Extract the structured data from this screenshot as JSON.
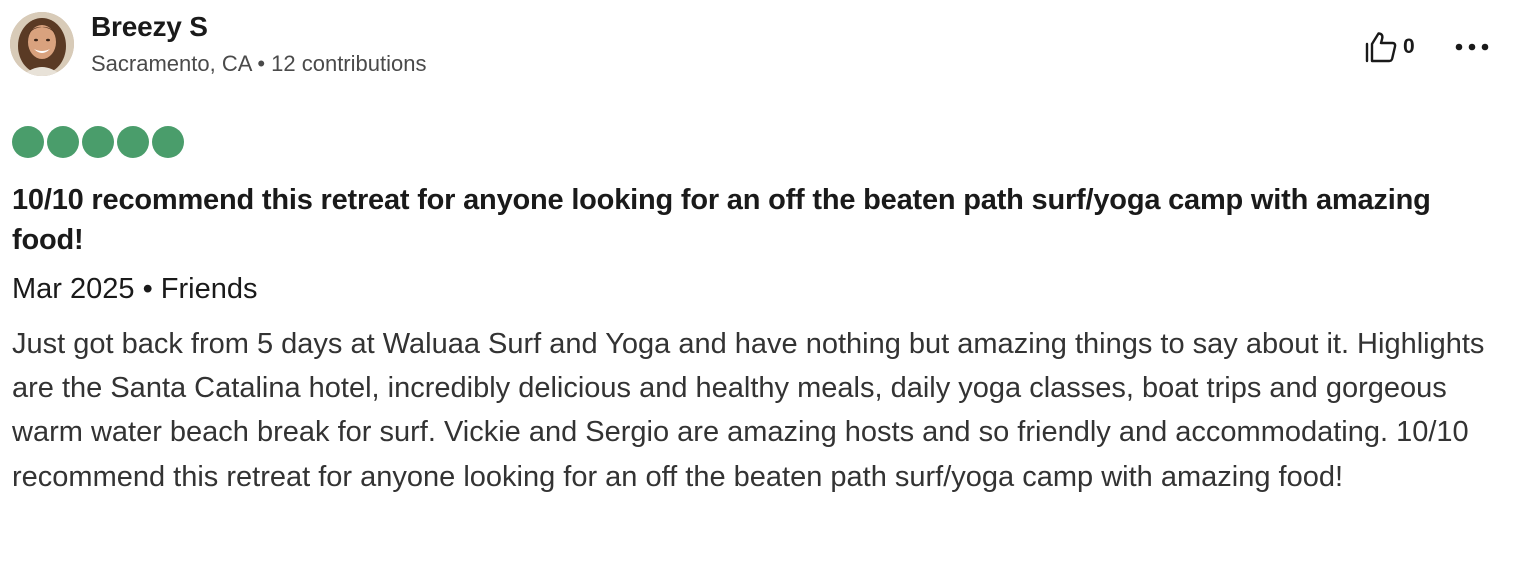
{
  "reviewer": {
    "name": "Breezy S",
    "location": "Sacramento, CA",
    "separator": "•",
    "contributions": "12 contributions"
  },
  "helpful": {
    "icon": "thumbs-up-icon",
    "count": "0"
  },
  "more_menu": {
    "icon": "more-horizontal-icon"
  },
  "rating": {
    "value": 5,
    "max": 5,
    "color": "#4a9d6b"
  },
  "review": {
    "title": "10/10 recommend this retreat for anyone looking for an off the beaten path surf/yoga camp with amazing food!",
    "date": "Mar 2025",
    "separator": "•",
    "trip_type": "Friends",
    "body": "Just got back from 5 days at Waluaa Surf and Yoga and have nothing but amazing things to say about it. Highlights are the Santa Catalina hotel, incredibly delicious and healthy meals, daily yoga classes, boat trips and gorgeous warm water beach break for surf. Vickie and Sergio are amazing hosts and so friendly and accommodating. 10/10 recommend this retreat for anyone looking for an off the beaten path surf/yoga camp with amazing food!"
  }
}
